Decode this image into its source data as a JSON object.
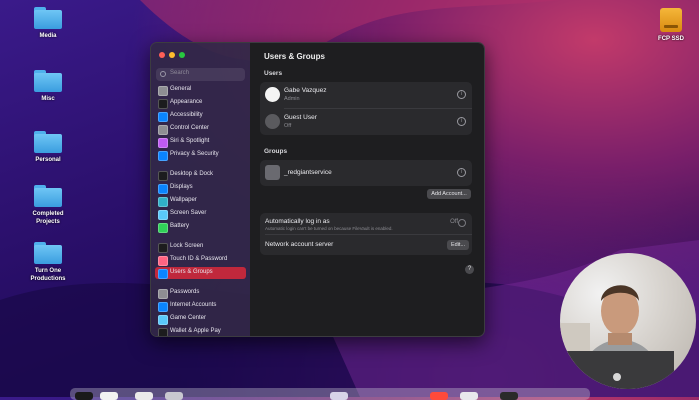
{
  "desktop": {
    "icons": [
      {
        "label": "Media"
      },
      {
        "label": "Misc"
      },
      {
        "label": "Personal"
      },
      {
        "label": "Completed Projects"
      },
      {
        "label": "Turn One Productions"
      }
    ],
    "drive_label": "FCP SSD"
  },
  "window": {
    "search_placeholder": "Search",
    "sidebar": [
      {
        "label": "General",
        "color": "#8e8e93"
      },
      {
        "label": "Appearance",
        "color": "#1c1c1e"
      },
      {
        "label": "Accessibility",
        "color": "#0a84ff"
      },
      {
        "label": "Control Center",
        "color": "#8e8e93"
      },
      {
        "label": "Siri & Spotlight",
        "color": "#bf5af2"
      },
      {
        "label": "Privacy & Security",
        "color": "#0a84ff"
      },
      {
        "label": "Desktop & Dock",
        "color": "#1c1c1e"
      },
      {
        "label": "Displays",
        "color": "#0a84ff"
      },
      {
        "label": "Wallpaper",
        "color": "#30b0c7"
      },
      {
        "label": "Screen Saver",
        "color": "#5ac8fa"
      },
      {
        "label": "Battery",
        "color": "#30d158"
      },
      {
        "label": "Lock Screen",
        "color": "#1c1c1e"
      },
      {
        "label": "Touch ID & Password",
        "color": "#ff6482"
      },
      {
        "label": "Users & Groups",
        "color": "#0a84ff"
      },
      {
        "label": "Passwords",
        "color": "#8e8e93"
      },
      {
        "label": "Internet Accounts",
        "color": "#0a84ff"
      },
      {
        "label": "Game Center",
        "color": "#5ac8fa"
      },
      {
        "label": "Wallet & Apple Pay",
        "color": "#1c1c1e"
      }
    ],
    "title": "Users & Groups",
    "users_heading": "Users",
    "users": [
      {
        "name": "Gabe Vazquez",
        "role": "Admin"
      },
      {
        "name": "Guest User",
        "role": "Off"
      }
    ],
    "groups_heading": "Groups",
    "groups": [
      {
        "name": "_redgiantservice"
      }
    ],
    "add_account": "Add Account...",
    "auto_login": {
      "label": "Automatically log in as",
      "note": "Automatic login can't be turned on because FileVault is enabled.",
      "value": "Off"
    },
    "network_server": {
      "label": "Network account server",
      "button": "Edit..."
    },
    "help": "?",
    "info_glyph": "i"
  },
  "accent_color": "#c0283c"
}
